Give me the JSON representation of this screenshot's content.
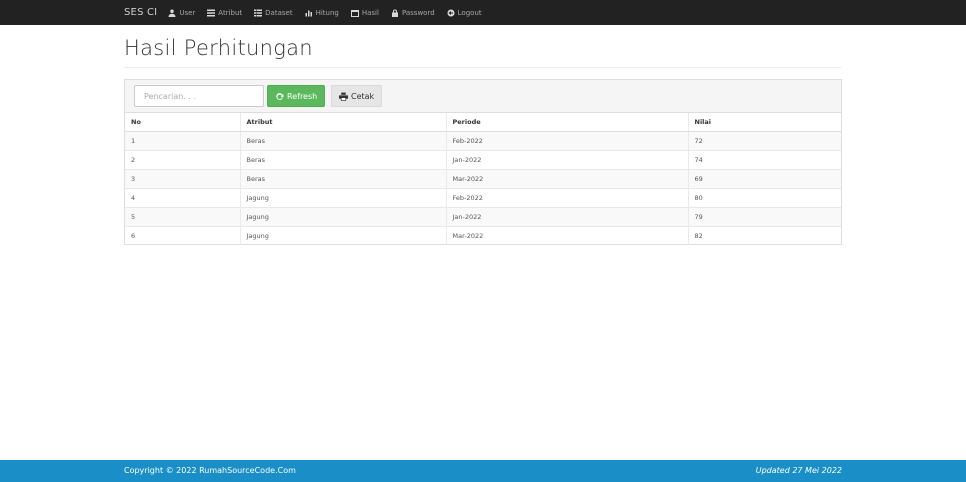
{
  "navbar": {
    "brand": "SES CI",
    "items": [
      {
        "label": "User",
        "icon": "user-icon"
      },
      {
        "label": "Atribut",
        "icon": "list-icon"
      },
      {
        "label": "Dataset",
        "icon": "table-icon"
      },
      {
        "label": "Hitung",
        "icon": "bar-chart-icon"
      },
      {
        "label": "Hasil",
        "icon": "calendar-icon"
      },
      {
        "label": "Password",
        "icon": "lock-icon"
      },
      {
        "label": "Logout",
        "icon": "logout-icon"
      }
    ]
  },
  "page": {
    "title": "Hasil Perhitungan"
  },
  "toolbar": {
    "search_placeholder": "Pencarian. . .",
    "refresh_label": "Refresh",
    "print_label": "Cetak"
  },
  "table": {
    "headers": [
      "No",
      "Atribut",
      "Periode",
      "Nilai"
    ],
    "rows": [
      [
        "1",
        "Beras",
        "Feb-2022",
        "72"
      ],
      [
        "2",
        "Beras",
        "Jan-2022",
        "74"
      ],
      [
        "3",
        "Beras",
        "Mar-2022",
        "69"
      ],
      [
        "4",
        "Jagung",
        "Feb-2022",
        "80"
      ],
      [
        "5",
        "Jagung",
        "Jan-2022",
        "79"
      ],
      [
        "6",
        "Jagung",
        "Mar-2022",
        "82"
      ]
    ]
  },
  "footer": {
    "copyright": "Copyright © 2022 RumahSourceCode.Com",
    "updated": "Updated 27 Mei 2022"
  },
  "colors": {
    "navbar_bg": "#222222",
    "refresh_green": "#5cb85c",
    "footer_blue": "#1a8fc7"
  }
}
